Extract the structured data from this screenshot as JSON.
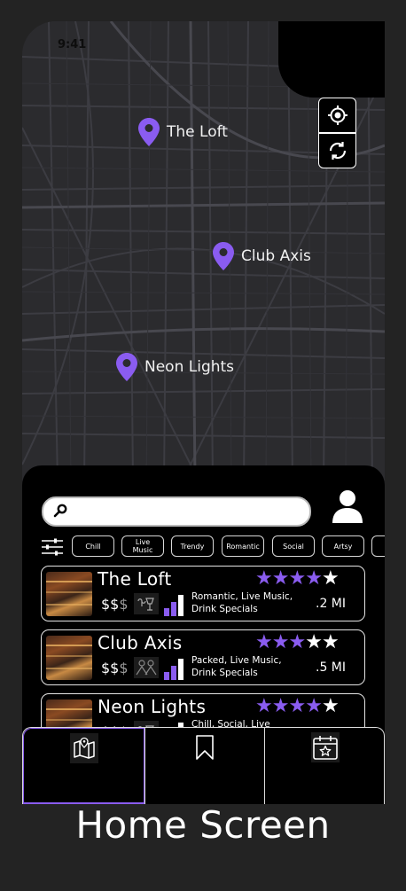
{
  "status_bar": {
    "time": "9:41"
  },
  "map": {
    "pins": [
      {
        "label": "The Loft"
      },
      {
        "label": "Club Axis"
      },
      {
        "label": "Neon Lights"
      }
    ],
    "controls": {
      "locate_icon": "crosshair-icon",
      "refresh_icon": "refresh-icon"
    }
  },
  "search": {
    "placeholder": "",
    "icon": "search-icon"
  },
  "filters": {
    "icon": "sliders-icon",
    "chips": [
      "Chill",
      "Live Music",
      "Trendy",
      "Romantic",
      "Social",
      "Artsy",
      ""
    ]
  },
  "venues": [
    {
      "name": "The Loft",
      "rating": 4,
      "price": "$$",
      "price_dim": "$",
      "tags": "Romantic, Live Music, Drink Specials",
      "distance": ".2 MI"
    },
    {
      "name": "Club Axis",
      "rating": 3,
      "price": "$$",
      "price_dim": "$",
      "tags": "Packed, Live Music, Drink Specials",
      "distance": ".5 MI"
    },
    {
      "name": "Neon Lights",
      "rating": 4,
      "price": "$$",
      "price_dim": "$",
      "tags": "Chill, Social, Live",
      "distance": ""
    }
  ],
  "nav": {
    "tabs": [
      "map-icon",
      "bookmark-icon",
      "calendar-star-icon"
    ],
    "active": 0
  },
  "caption": "Home Screen",
  "colors": {
    "accent": "#8a5cf0",
    "background": "#232323",
    "map": "#2a2a2d"
  }
}
